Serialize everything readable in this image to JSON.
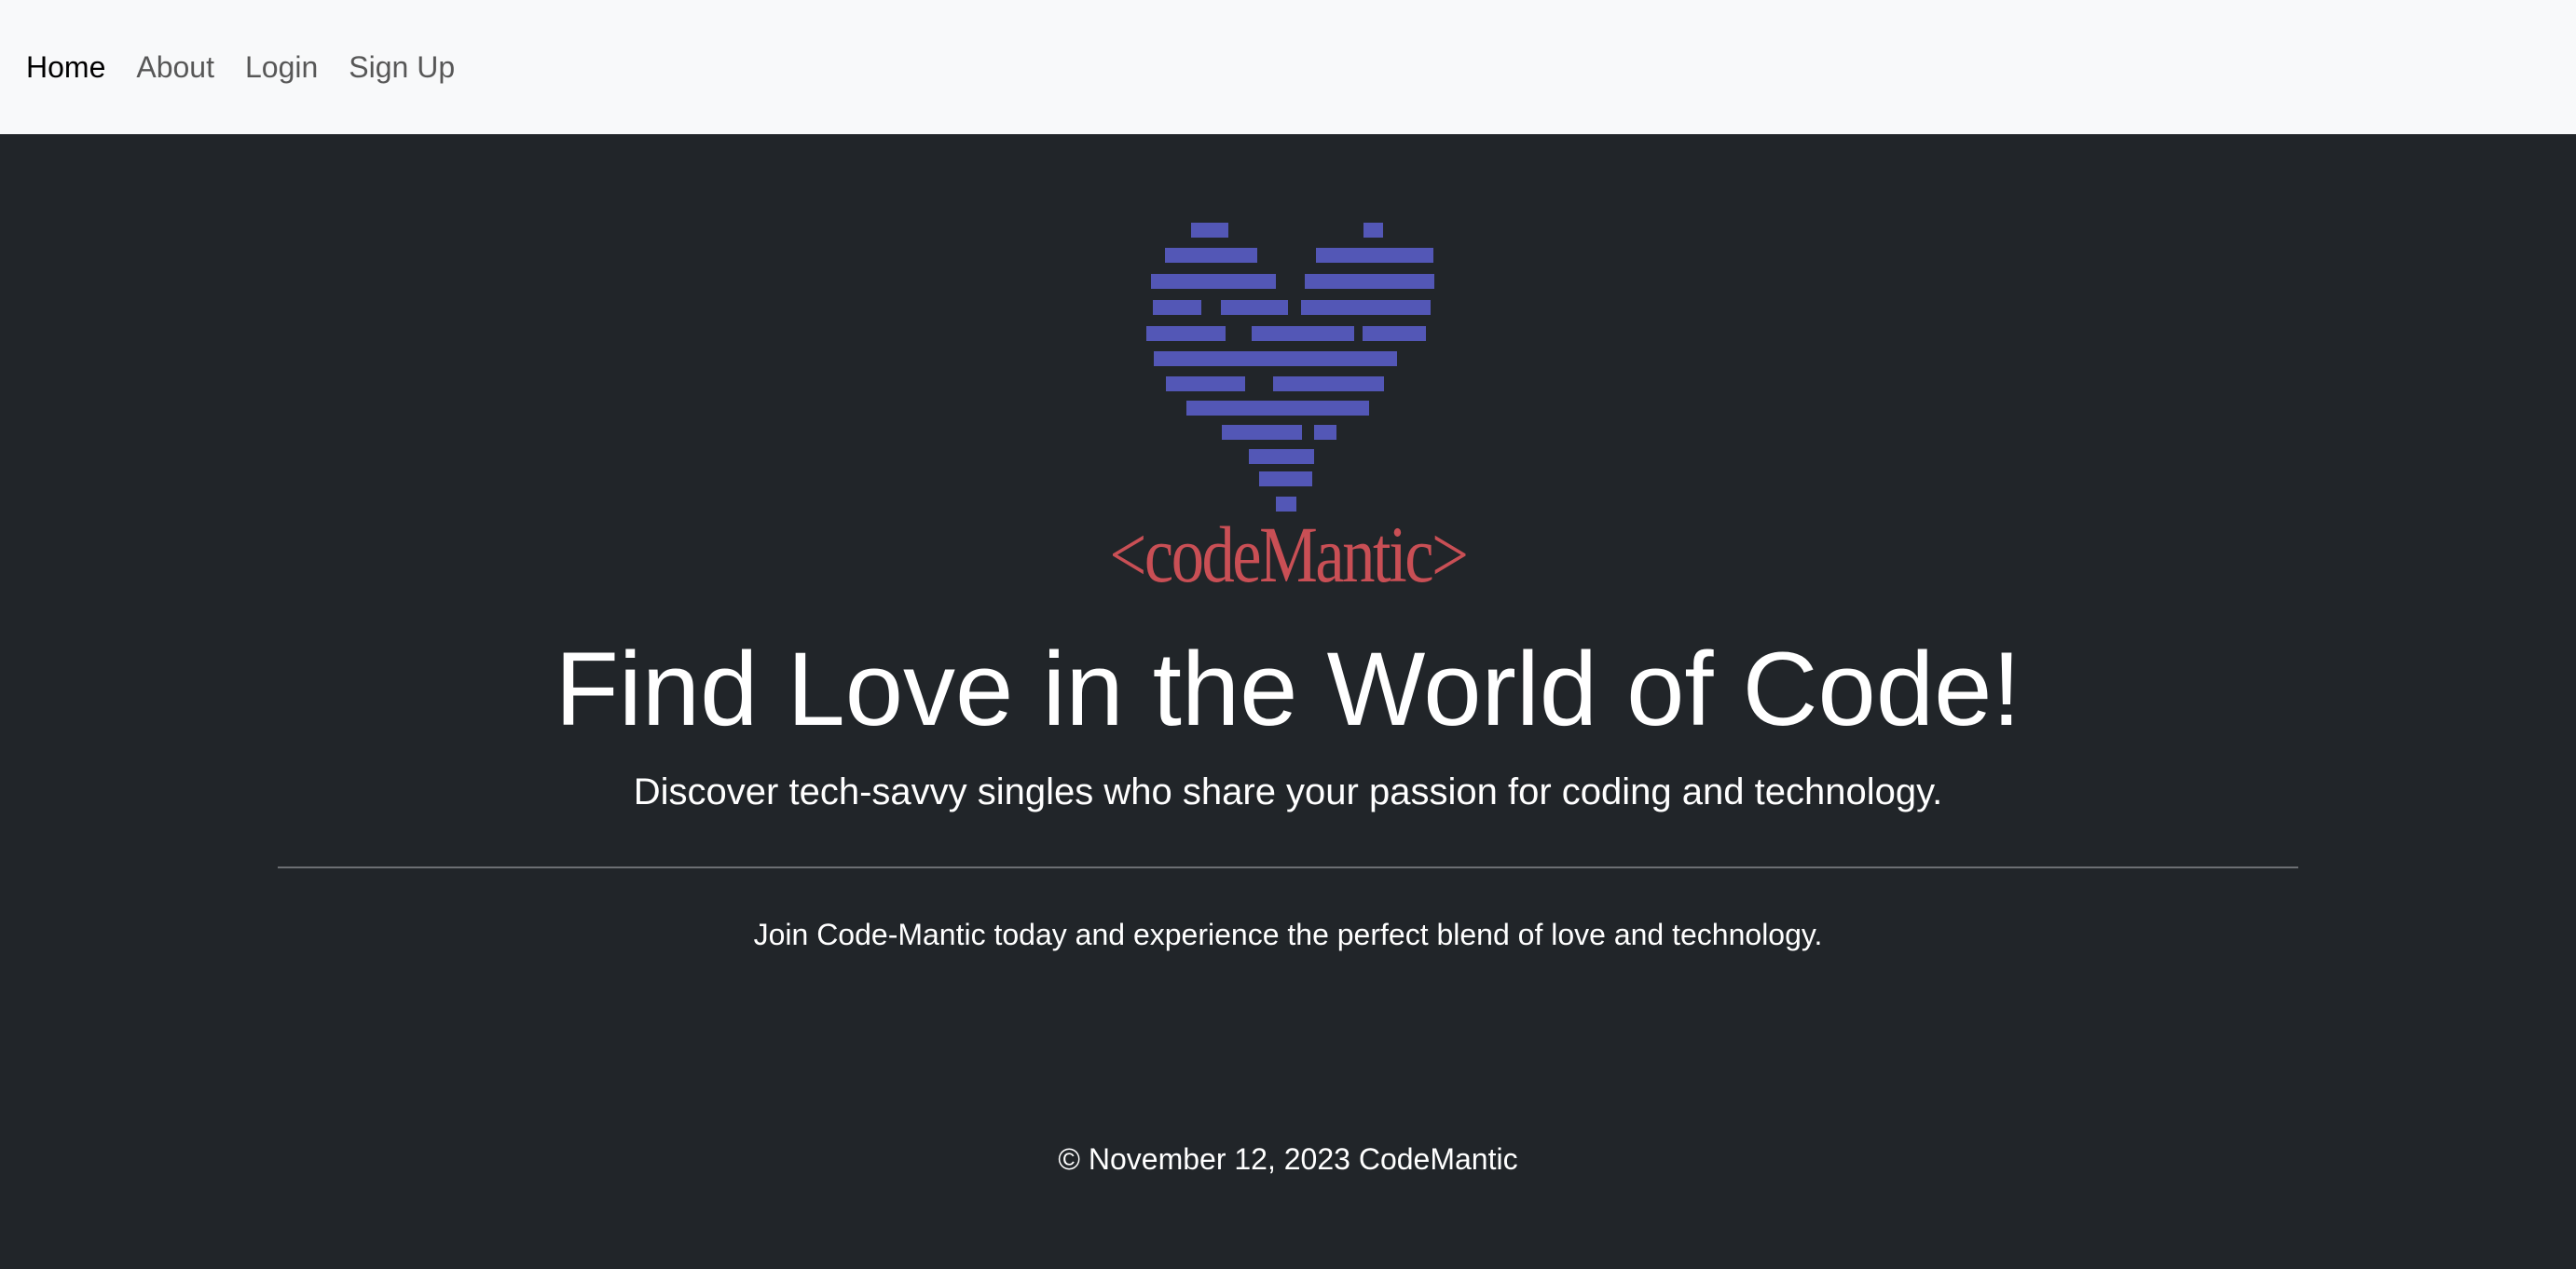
{
  "nav": {
    "items": [
      {
        "label": "Home",
        "active": true
      },
      {
        "label": "About",
        "active": false
      },
      {
        "label": "Login",
        "active": false
      },
      {
        "label": "Sign Up",
        "active": false
      }
    ]
  },
  "hero": {
    "logo_icon": "code-heart-icon",
    "logo_text": "<codeMantic>",
    "headline": "Find Love in the World of Code!",
    "lead": "Discover tech-savvy singles who share your passion for coding and technology.",
    "join_text": "Join Code-Mantic today and experience the perfect blend of love and technology."
  },
  "footer": {
    "copyright": "© November 12, 2023 CodeMantic"
  },
  "colors": {
    "navbar_bg": "#f8f9fa",
    "page_bg": "#212529",
    "logo_heart": "#5357b6",
    "logo_text": "#c94f55"
  }
}
